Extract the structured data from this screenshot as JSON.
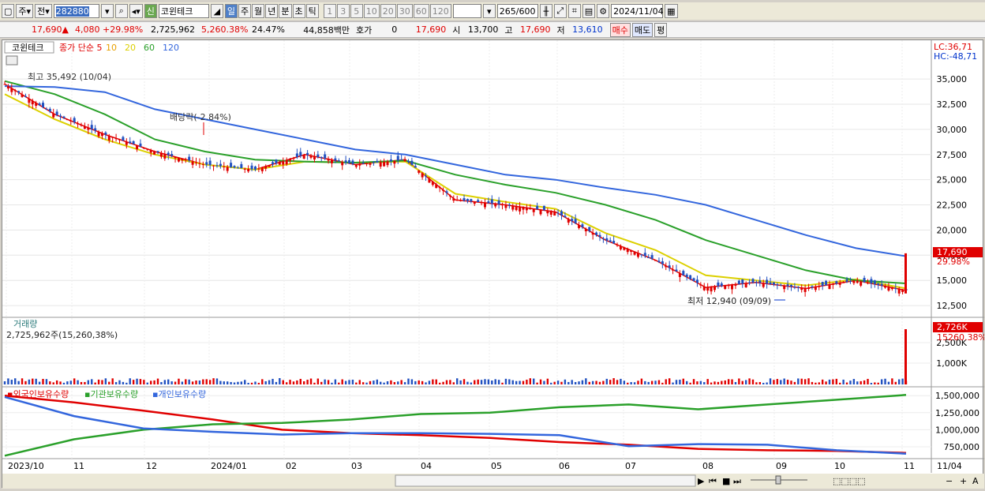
{
  "toolbar": {
    "type_label": "주",
    "exch_label": "전",
    "stock_code": "282880",
    "stock_name": "코윈테크",
    "new_badge": "신",
    "periods": [
      "일",
      "주",
      "월",
      "년",
      "분",
      "초",
      "틱"
    ],
    "active_period": "일",
    "intervals": [
      "1",
      "3",
      "5",
      "10",
      "20",
      "30",
      "60",
      "120"
    ],
    "count": "265",
    "count_total": "/600",
    "date": "2024/11/04"
  },
  "info": {
    "price": "17,690",
    "arrow": "▲",
    "change": "4,080",
    "change_pct": "+29.98%",
    "volume": "2,725,962",
    "vol_pct": "5,260.38%",
    "turnover": "24.47%",
    "amount": "44,858백만",
    "hoga_label": "호가",
    "hoga": "0",
    "ask": "17,690",
    "open_label": "시",
    "open": "13,700",
    "high_label": "고",
    "high": "17,690",
    "low_label": "저",
    "low": "13,610",
    "buy": "매수",
    "sell": "매도",
    "eval": "평"
  },
  "price_panel": {
    "name": "코윈테크",
    "legend": [
      {
        "label": "종가 단순 5",
        "color": "#e00000"
      },
      {
        "label": "10",
        "color": "#e8a000"
      },
      {
        "label": "20",
        "color": "#dcd000"
      },
      {
        "label": "60",
        "color": "#2aa02a"
      },
      {
        "label": "120",
        "color": "#3366dd"
      }
    ],
    "lc": "LC:36,71",
    "hc": "HC:-48,71",
    "high_note": "최고 35,492 (10/04)",
    "dividend_note": "배당락(-2.84%)",
    "low_note": "최저 12,940 (09/09)",
    "current_tag": "17,690",
    "current_pct": "29.98%"
  },
  "volume_panel": {
    "title": "거래량",
    "value": "2,725,962주(15,260,38%)",
    "tag": "2,726K",
    "tag_pct": "15260.38%"
  },
  "holding_panel": {
    "legend": [
      {
        "label": "외국인보유수량",
        "color": "#e00000"
      },
      {
        "label": "기관보유수량",
        "color": "#2aa02a"
      },
      {
        "label": "개인보유수량",
        "color": "#3366dd"
      }
    ]
  },
  "x_labels": [
    {
      "t": "2023/10",
      "x": 5
    },
    {
      "t": "11",
      "x": 88
    },
    {
      "t": "12",
      "x": 180
    },
    {
      "t": "2024/01",
      "x": 262
    },
    {
      "t": "02",
      "x": 357
    },
    {
      "t": "03",
      "x": 440
    },
    {
      "t": "04",
      "x": 528
    },
    {
      "t": "05",
      "x": 617
    },
    {
      "t": "06",
      "x": 703
    },
    {
      "t": "07",
      "x": 787
    },
    {
      "t": "08",
      "x": 885
    },
    {
      "t": "09",
      "x": 978
    },
    {
      "t": "10",
      "x": 1052
    },
    {
      "t": "11",
      "x": 1140
    }
  ],
  "axis_right_date": "11/04",
  "chart_data": {
    "type": "line",
    "price_axis": {
      "ticks": [
        "35,000",
        "32,500",
        "30,000",
        "27,500",
        "25,000",
        "22,500",
        "20,000",
        "17,500",
        "15,000",
        "12,500"
      ],
      "ylim": [
        11800,
        36500
      ]
    },
    "volume_axis": {
      "ticks": [
        "2,500K",
        "1,000K"
      ]
    },
    "holding_axis": {
      "ticks": [
        "1,500,000",
        "1,250,000",
        "1,000,000",
        "750,000"
      ]
    },
    "x": [
      "2023/10",
      "11",
      "12",
      "2024/01",
      "02",
      "03",
      "04",
      "05",
      "06",
      "07",
      "08",
      "09",
      "10",
      "11"
    ],
    "series": [
      {
        "name": "종가 단순 5",
        "values": [
          34500,
          31500,
          29500,
          27800,
          26500,
          26000,
          27500,
          26500,
          27000,
          23000,
          22500,
          21800,
          19000,
          17000,
          14300,
          14800,
          14200,
          15000,
          14000
        ]
      },
      {
        "name": "20",
        "values": [
          33500,
          31000,
          29000,
          27500,
          26500,
          26000,
          26800,
          26700,
          26800,
          23600,
          22800,
          22100,
          19700,
          18000,
          15500,
          15000,
          14500,
          15100,
          14200
        ]
      },
      {
        "name": "60",
        "values": [
          34800,
          33500,
          31500,
          29000,
          27800,
          27000,
          26800,
          26700,
          26900,
          25500,
          24500,
          23700,
          22500,
          21000,
          19000,
          17500,
          16000,
          15000,
          14700
        ]
      },
      {
        "name": "120",
        "values": [
          34300,
          34200,
          33700,
          32000,
          31000,
          30000,
          29000,
          28000,
          27500,
          26500,
          25500,
          25000,
          24200,
          23500,
          22500,
          21000,
          19500,
          18200,
          17400
        ]
      }
    ],
    "holding": [
      {
        "name": "외국인보유수량",
        "values": [
          1500000,
          1400000,
          1280000,
          1150000,
          1000000,
          950000,
          920000,
          880000,
          820000,
          780000,
          720000,
          700000,
          690000,
          660000
        ]
      },
      {
        "name": "기관보유수량",
        "values": [
          620000,
          860000,
          1000000,
          1080000,
          1100000,
          1150000,
          1230000,
          1250000,
          1330000,
          1370000,
          1300000,
          1370000,
          1440000,
          1510000
        ]
      },
      {
        "name": "개인보유수량",
        "values": [
          1480000,
          1200000,
          1020000,
          970000,
          930000,
          950000,
          950000,
          940000,
          920000,
          760000,
          790000,
          780000,
          700000,
          650000
        ]
      }
    ],
    "last_volume": "2,725,962"
  }
}
